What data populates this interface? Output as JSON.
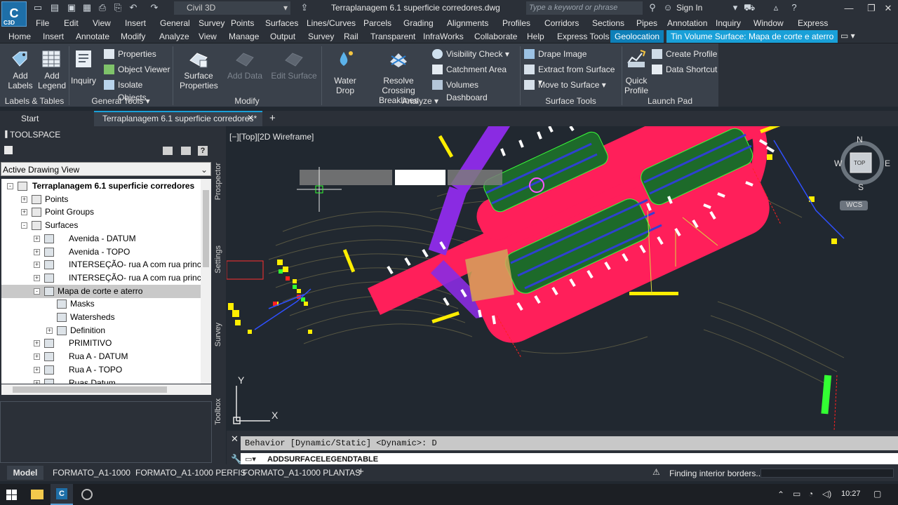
{
  "app": {
    "logo_text": "C",
    "logo_badge": "C3D",
    "workspace": "Civil 3D",
    "document_title": "Terraplanagem 6.1 superficie corredores.dwg",
    "search_placeholder": "Type a keyword or phrase",
    "sign_in": "Sign In"
  },
  "menu": [
    "File",
    "Edit",
    "View",
    "Insert",
    "General",
    "Survey",
    "Points",
    "Surfaces",
    "Lines/Curves",
    "Parcels",
    "Grading",
    "Alignments",
    "Profiles",
    "Corridors",
    "Sections",
    "Pipes",
    "Annotation",
    "Inquiry",
    "Window",
    "Express"
  ],
  "ribbon_tabs": [
    "Home",
    "Insert",
    "Annotate",
    "Modify",
    "Analyze",
    "View",
    "Manage",
    "Output",
    "Survey",
    "Rail",
    "Transparent",
    "InfraWorks",
    "Collaborate",
    "Help",
    "Express Tools",
    "Geolocation",
    "Tin Volume Surface: Mapa de corte e aterro"
  ],
  "ribbon": {
    "labels_tables": {
      "title": "Labels & Tables",
      "add_labels": "Add Labels",
      "add_legend": "Add Legend"
    },
    "general_tools": {
      "title": "General Tools",
      "inquiry": "Inquiry",
      "properties": "Properties",
      "object_viewer": "Object Viewer",
      "isolate_objects": "Isolate Objects"
    },
    "modify": {
      "title": "Modify",
      "surface_properties": "Surface Properties",
      "add_data": "Add Data",
      "edit_surface": "Edit Surface"
    },
    "analyze": {
      "title": "Analyze",
      "water_drop": "Water Drop",
      "resolve_crossing": "Resolve Crossing Breaklines",
      "visibility_check": "Visibility Check",
      "catchment_area": "Catchment Area",
      "volumes_dashboard": "Volumes Dashboard"
    },
    "surface_tools": {
      "title": "Surface Tools",
      "drape_image": "Drape Image",
      "extract_from_surface": "Extract from Surface",
      "move_to_surface": "Move to Surface"
    },
    "launch_pad": {
      "title": "Launch Pad",
      "quick_profile": "Quick Profile",
      "create_profile": "Create Profile",
      "data_shortcut": "Data Shortcut"
    }
  },
  "doc_tabs": {
    "start": "Start",
    "active": "Terraplanagem 6.1 superficie corredores*"
  },
  "toolspace": {
    "title": "TOOLSPACE",
    "view_select": "Active Drawing View",
    "tree": [
      {
        "label": "Terraplanagem 6.1 superficie corredores",
        "level": 0,
        "toggle": "-",
        "bold": true
      },
      {
        "label": "Points",
        "level": 1,
        "toggle": "+"
      },
      {
        "label": "Point Groups",
        "level": 1,
        "toggle": "+"
      },
      {
        "label": "Surfaces",
        "level": 1,
        "toggle": "-"
      },
      {
        "label": "Avenida - DATUM",
        "level": 2,
        "toggle": "+"
      },
      {
        "label": "Avenida - TOPO",
        "level": 2,
        "toggle": "+"
      },
      {
        "label": "INTERSEÇÃO- rua A com rua princi...",
        "level": 2,
        "toggle": "+"
      },
      {
        "label": "INTERSEÇÃO- rua A com rua princi...",
        "level": 2,
        "toggle": "+"
      },
      {
        "label": "Mapa de corte e aterro",
        "level": 2,
        "toggle": "-",
        "selected": true
      },
      {
        "label": "Masks",
        "level": 3,
        "toggle": ""
      },
      {
        "label": "Watersheds",
        "level": 3,
        "toggle": ""
      },
      {
        "label": "Definition",
        "level": 3,
        "toggle": "+"
      },
      {
        "label": "PRIMITIVO",
        "level": 2,
        "toggle": "+"
      },
      {
        "label": "Rua A - DATUM",
        "level": 2,
        "toggle": "+"
      },
      {
        "label": "Rua A - TOPO",
        "level": 2,
        "toggle": "+"
      },
      {
        "label": "Ruas Datum",
        "level": 2,
        "toggle": "+"
      }
    ],
    "side_tabs": [
      "Prospector",
      "Settings",
      "Survey",
      "Toolbox"
    ]
  },
  "viewport": {
    "label": "[−][Top][2D Wireframe]",
    "compass": {
      "n": "N",
      "s": "S",
      "e": "E",
      "w": "W",
      "top": "TOP"
    },
    "wcs": "WCS",
    "ucs_y": "Y",
    "ucs_x": "X"
  },
  "command": {
    "history": "Behavior [Dynamic/Static] <Dynamic>: D",
    "input": "ADDSURFACELEGENDTABLE"
  },
  "layout_tabs": [
    "Model",
    "FORMATO_A1-1000",
    "FORMATO_A1-1000 PERFIS",
    "FORMATO_A1-1000 PLANTAS"
  ],
  "status": {
    "text": "Finding interior borders..."
  },
  "taskbar": {
    "time": "10:27"
  },
  "colors": {
    "accent": "#19a0d8",
    "road": "#ff1f5a",
    "purple": "#8a2be2",
    "bg": "#212830"
  }
}
